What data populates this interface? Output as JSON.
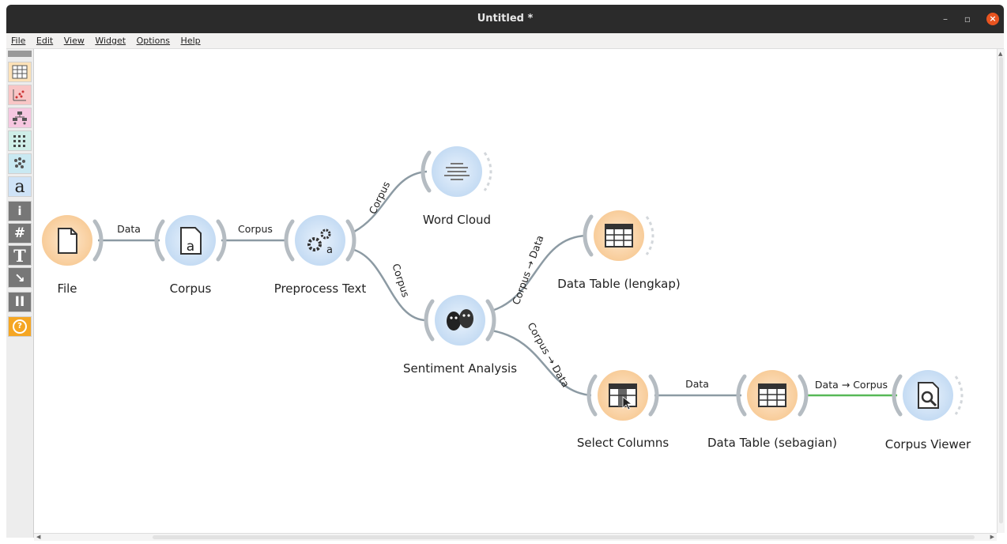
{
  "window": {
    "title": "Untitled *"
  },
  "menu": [
    "File",
    "Edit",
    "View",
    "Widget",
    "Options",
    "Help"
  ],
  "toolbox": {
    "categories": [
      {
        "name": "data-category",
        "icon": "table-icon",
        "bg": "#fde2b8"
      },
      {
        "name": "visualize-category",
        "icon": "scatter-plot-icon",
        "bg": "#f8c6c6"
      },
      {
        "name": "model-category",
        "icon": "tree-icon",
        "bg": "#f6c7e0"
      },
      {
        "name": "evaluate-category",
        "icon": "grid-icon",
        "bg": "#cfeee8"
      },
      {
        "name": "unsupervised-category",
        "icon": "cluster-icon",
        "bg": "#c9e9f2"
      },
      {
        "name": "text-mining-category",
        "icon": "text-a-icon",
        "bg": "#cfe3f7"
      }
    ],
    "tools": [
      {
        "name": "info-tool",
        "icon": "info-icon",
        "label": "i"
      },
      {
        "name": "hash-tool",
        "icon": "hash-icon",
        "label": "#"
      },
      {
        "name": "text-annotation-tool",
        "icon": "text-t-icon",
        "label": "T"
      },
      {
        "name": "arrow-annotation-tool",
        "icon": "arrow-icon",
        "label": "↘"
      },
      {
        "name": "pause-tool",
        "icon": "pause-icon",
        "label": "II"
      },
      {
        "name": "help-tool",
        "icon": "help-icon",
        "label": "?"
      }
    ]
  },
  "colors": {
    "data_widget": "#fbd7ae",
    "text_widget": "#cfe2f6",
    "link": "#8c9aa3",
    "active_link": "#57b857"
  },
  "nodes": [
    {
      "id": "file",
      "label": "File",
      "icon": "file-icon",
      "kind": "data"
    },
    {
      "id": "corpus",
      "label": "Corpus",
      "icon": "corpus-icon",
      "kind": "text"
    },
    {
      "id": "preprocess",
      "label": "Preprocess Text",
      "icon": "gears-icon",
      "kind": "text"
    },
    {
      "id": "wordcloud",
      "label": "Word Cloud",
      "icon": "word-cloud-icon",
      "kind": "text"
    },
    {
      "id": "sentiment",
      "label": "Sentiment Analysis",
      "icon": "masks-icon",
      "kind": "text"
    },
    {
      "id": "dt_lengkap",
      "label": "Data Table (lengkap)",
      "icon": "table-icon",
      "kind": "data"
    },
    {
      "id": "selectcols",
      "label": "Select Columns",
      "icon": "select-columns-icon",
      "kind": "data"
    },
    {
      "id": "dt_sebagian",
      "label": "Data Table (sebagian)",
      "icon": "table-icon",
      "kind": "data"
    },
    {
      "id": "corpusviewer",
      "label": "Corpus Viewer",
      "icon": "magnifier-doc-icon",
      "kind": "text"
    }
  ],
  "links": [
    {
      "id": "file-corpus",
      "label": "Data"
    },
    {
      "id": "corpus-preprocess",
      "label": "Corpus"
    },
    {
      "id": "preprocess-wordcloud",
      "label": "Corpus"
    },
    {
      "id": "preprocess-sentiment",
      "label": "Corpus"
    },
    {
      "id": "sentiment-dtlengkap",
      "label": "Corpus → Data"
    },
    {
      "id": "sentiment-selectcols",
      "label": "Corpus → Data"
    },
    {
      "id": "selectcols-dtsebagian",
      "label": "Data"
    },
    {
      "id": "dtsebagian-corpusviewer",
      "label": "Data → Corpus"
    }
  ]
}
